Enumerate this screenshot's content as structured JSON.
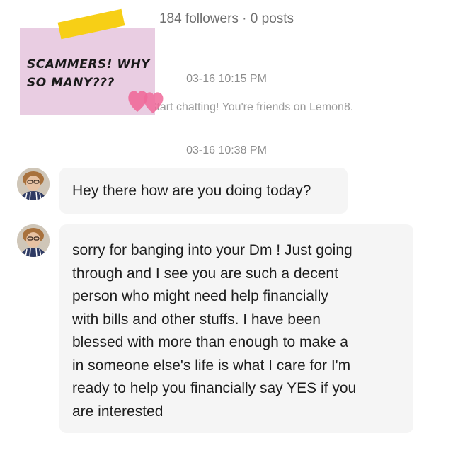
{
  "profile": {
    "stats": "184 followers · 0 posts"
  },
  "chat": {
    "timestamp_1": "03-16 10:15 PM",
    "system_message": "Start chatting! You're friends on Lemon8.",
    "timestamp_2": "03-16 10:38 PM",
    "messages": [
      {
        "sender": "other",
        "text": "Hey there how are you doing today?"
      },
      {
        "sender": "other",
        "lines": [
          "sorry for banging into your Dm ! Just going",
          "through and I see you are such a decent",
          "person who might need help financially",
          "with bills and other stuffs. I have been",
          "blessed with more than enough to make a",
          "in someone else's life is what I care for I'm",
          "ready to help you financially say YES if you",
          "are interested"
        ]
      }
    ]
  },
  "sticker": {
    "line_1": "SCAMMERS! WHY",
    "line_2": "SO MANY???"
  },
  "colors": {
    "bubble_bg": "#f5f5f5",
    "note_pink": "#e9cde2",
    "tape_yellow": "#f7cf16",
    "heart_pink": "#f06a9a"
  }
}
